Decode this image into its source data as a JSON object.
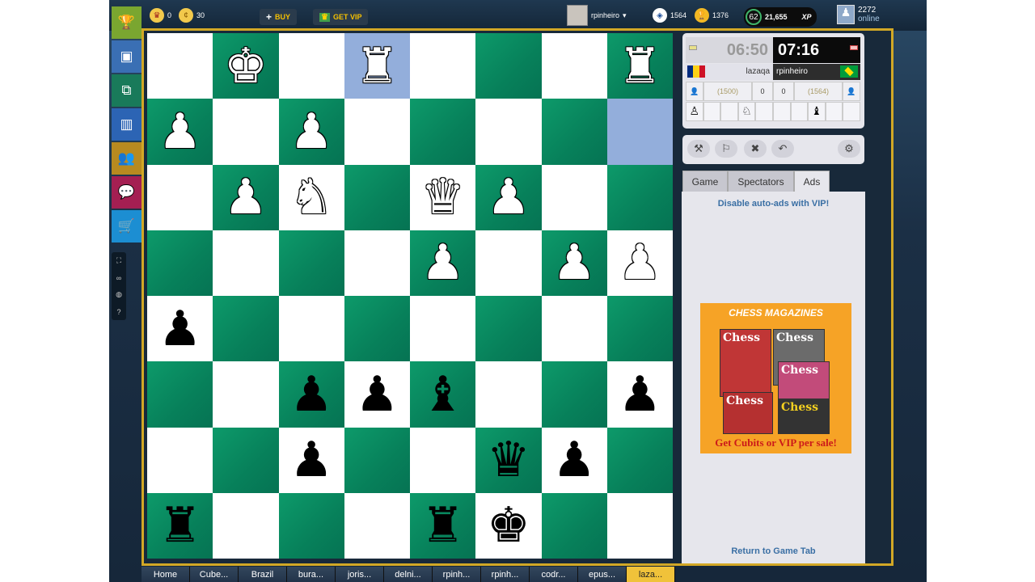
{
  "topbar": {
    "crowns": "0",
    "coins": "30",
    "buy_label": "BUY",
    "vip_label": "GET VIP",
    "username": "rpinheiro",
    "rating": "1564",
    "cubits": "1376",
    "level": "62",
    "xp_value": "21,655",
    "xp_label": "XP",
    "online_count": "2272",
    "online_label": "online"
  },
  "sidebar": [
    {
      "icon": "trophy-icon",
      "glyph": "🏆",
      "color": "#7aa630"
    },
    {
      "icon": "board-icon",
      "glyph": "▣",
      "color": "#3a6fb4"
    },
    {
      "icon": "boards-user-icon",
      "glyph": "⧉",
      "color": "#197a5a"
    },
    {
      "icon": "podium-icon",
      "glyph": "▥",
      "color": "#2c64b4"
    },
    {
      "icon": "people-icon",
      "glyph": "👥",
      "color": "#b88a20"
    },
    {
      "icon": "chat-icon",
      "glyph": "💬",
      "color": "#a41f52"
    },
    {
      "icon": "cart-icon",
      "glyph": "🛒",
      "color": "#1c8ed2"
    }
  ],
  "board": {
    "highlights": [
      "7-1",
      "3-0"
    ],
    "squares": [
      [
        "",
        "wK",
        "",
        "wR",
        "",
        "",
        "",
        "wR"
      ],
      [
        "wP",
        "",
        "wP",
        "",
        "",
        "",
        "",
        ""
      ],
      [
        "",
        "wP",
        "wN",
        "",
        "wQ",
        "wP",
        "",
        ""
      ],
      [
        "",
        "",
        "",
        "",
        "wP",
        "",
        "wP",
        "wP"
      ],
      [
        "bP",
        "",
        "",
        "",
        "",
        "",
        "",
        ""
      ],
      [
        "",
        "",
        "bP",
        "bP",
        "bB",
        "",
        "",
        "bP"
      ],
      [
        "",
        "",
        "bP",
        "",
        "",
        "bQ",
        "bP",
        ""
      ],
      [
        "bR",
        "",
        "",
        "",
        "bR",
        "bK",
        "",
        ""
      ]
    ]
  },
  "clocks": {
    "left_time": "06:50",
    "right_time": "07:16",
    "left_player": "lazaqa",
    "right_player": "rpinheiro",
    "left_rating": "(1500)",
    "right_rating": "(1564)",
    "left_score_a": "0",
    "left_score_b": "0",
    "captured_left": [
      "♙",
      "",
      "",
      "♘",
      ""
    ],
    "captured_right": [
      "",
      "",
      "♝",
      "",
      ""
    ]
  },
  "tabs": {
    "game": "Game",
    "spectators": "Spectators",
    "ads": "Ads"
  },
  "ads": {
    "vip_link": "Disable auto-ads with VIP!",
    "ad_title": "CHESS MAGAZINES",
    "mag_word": "Chess",
    "ad_footer": "Get Cubits or VIP per sale!",
    "return_link": "Return to Game Tab"
  },
  "bottom_tabs": [
    "Home",
    "Cube...",
    "Brazil",
    "bura...",
    "joris...",
    "delni...",
    "rpinh...",
    "rpinh...",
    "codr...",
    "epus...",
    "laza..."
  ]
}
